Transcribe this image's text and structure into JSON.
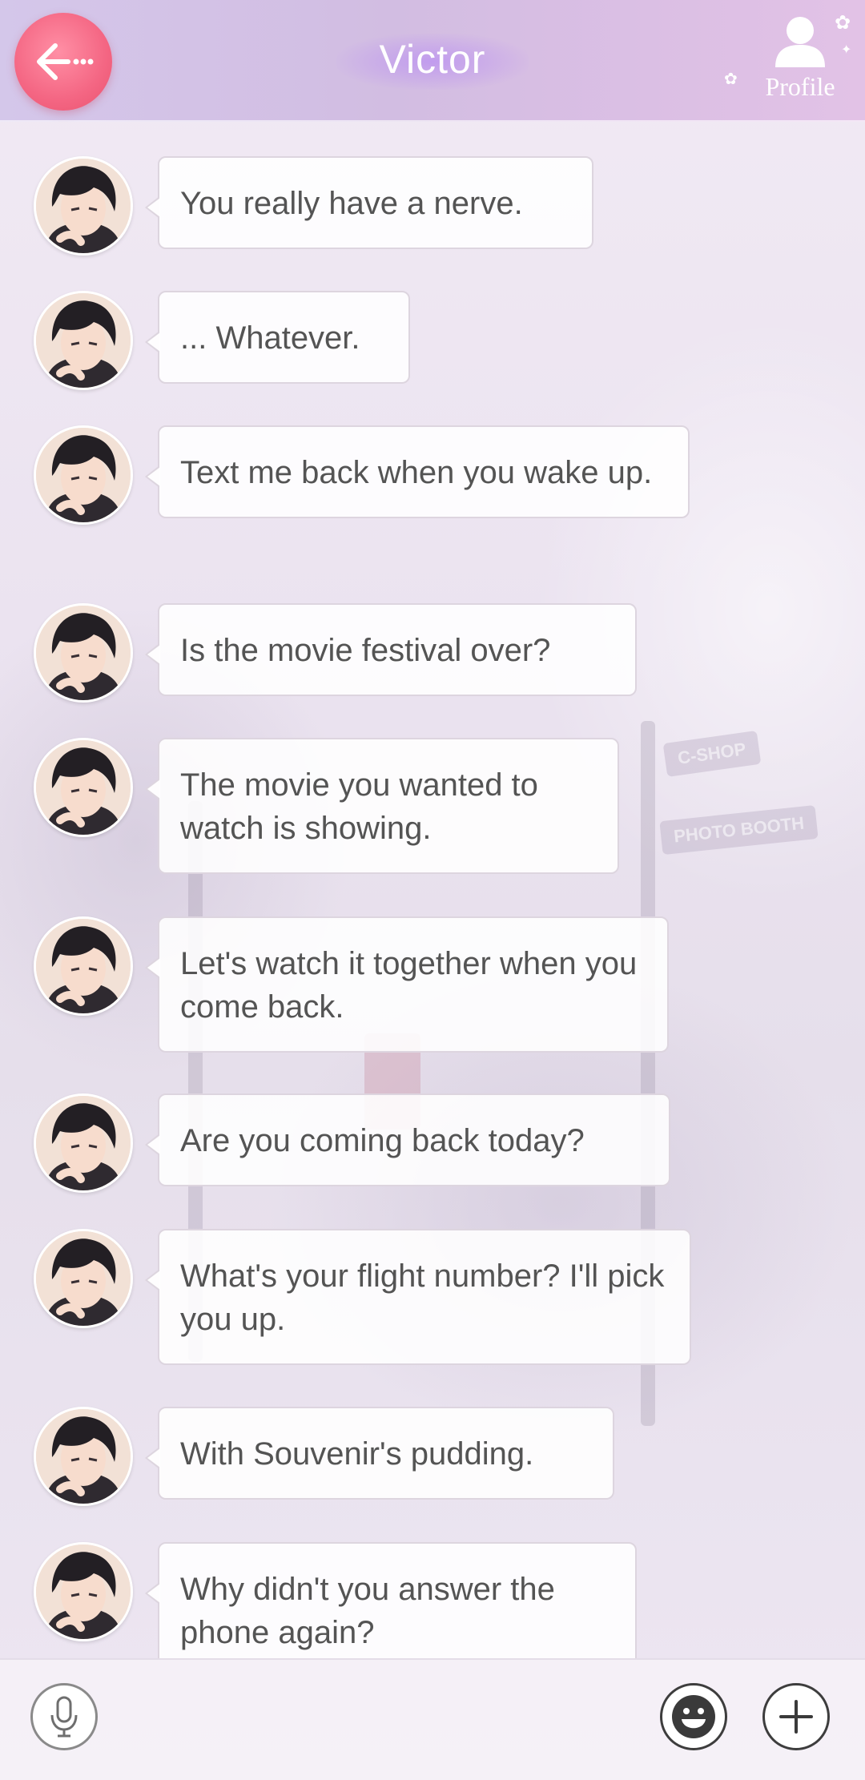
{
  "header": {
    "title": "Victor",
    "profile_label": "Profile",
    "back_icon": "back-arrow-icon",
    "profile_icon": "person-icon"
  },
  "messages": [
    {
      "sender": "Victor",
      "text": "You really have a nerve."
    },
    {
      "sender": "Victor",
      "text": "... Whatever."
    },
    {
      "sender": "Victor",
      "text": "Text me back when you wake up."
    },
    {
      "sender": "Victor",
      "text": "Is the movie festival over?"
    },
    {
      "sender": "Victor",
      "text": "The movie you wanted to watch is showing."
    },
    {
      "sender": "Victor",
      "text": "Let's watch it together when you come back."
    },
    {
      "sender": "Victor",
      "text": "Are you coming back today?"
    },
    {
      "sender": "Victor",
      "text": "What's your flight number? I'll pick you up."
    },
    {
      "sender": "Victor",
      "text": "With Souvenir's pudding."
    },
    {
      "sender": "Victor",
      "text": "Why didn't you answer the phone again?"
    }
  ],
  "background": {
    "sign_1": "C-SHOP",
    "sign_2": "PHOTO BOOTH"
  },
  "bottom_bar": {
    "left_icon": "microphone-icon",
    "middle_icon": "emoji-icon",
    "right_icon": "plus-icon"
  },
  "colors": {
    "back_button": "#f46683",
    "header_start": "#d4c7ea",
    "header_end": "#e2c2e6",
    "bubble_text": "#545454"
  }
}
